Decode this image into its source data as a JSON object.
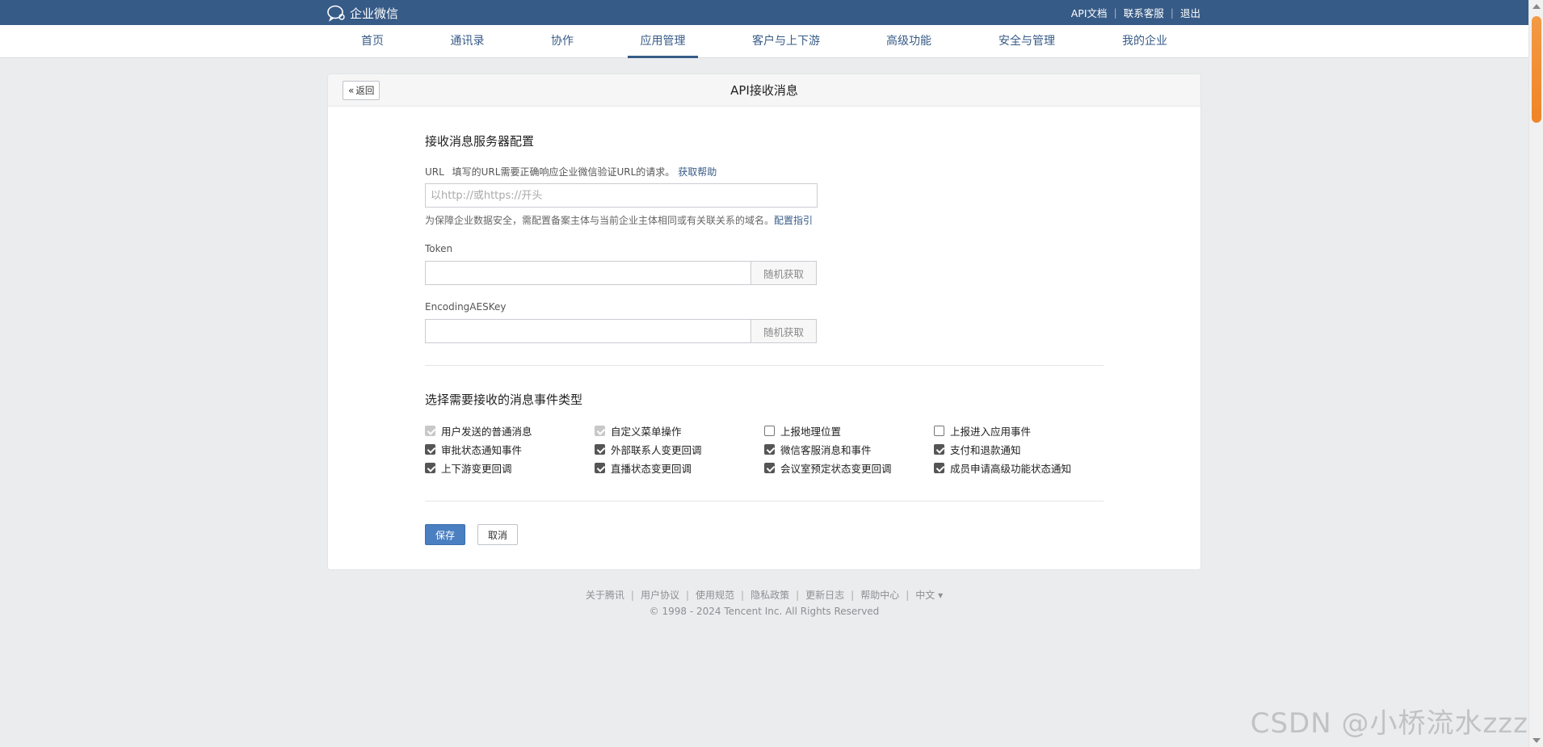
{
  "topbar": {
    "brand": "企业微信",
    "links": [
      "API文档",
      "联系客服",
      "退出"
    ],
    "separator": "|"
  },
  "nav": {
    "items": [
      "首页",
      "通讯录",
      "协作",
      "应用管理",
      "客户与上下游",
      "高级功能",
      "安全与管理",
      "我的企业"
    ],
    "active_index": 3
  },
  "card": {
    "back_label": "返回",
    "title": "API接收消息",
    "server_section_title": "接收消息服务器配置",
    "url": {
      "label": "URL",
      "desc": "填写的URL需要正确响应企业微信验证URL的请求。",
      "help": "获取帮助",
      "placeholder": "以http://或https://开头",
      "value": ""
    },
    "security_hint": "为保障企业数据安全，需配置备案主体与当前企业主体相同或有关联关系的域名。",
    "security_link": "配置指引",
    "token": {
      "label": "Token",
      "value": "",
      "button": "随机获取"
    },
    "aeskey": {
      "label": "EncodingAESKey",
      "value": "",
      "button": "随机获取"
    },
    "events_section_title": "选择需要接收的消息事件类型",
    "events": [
      {
        "label": "用户发送的普通消息",
        "state": "disabled"
      },
      {
        "label": "自定义菜单操作",
        "state": "disabled"
      },
      {
        "label": "上报地理位置",
        "state": "unchecked"
      },
      {
        "label": "上报进入应用事件",
        "state": "unchecked"
      },
      {
        "label": "审批状态通知事件",
        "state": "checked"
      },
      {
        "label": "外部联系人变更回调",
        "state": "checked"
      },
      {
        "label": "微信客服消息和事件",
        "state": "checked"
      },
      {
        "label": "支付和退款通知",
        "state": "checked"
      },
      {
        "label": "上下游变更回调",
        "state": "checked"
      },
      {
        "label": "直播状态变更回调",
        "state": "checked"
      },
      {
        "label": "会议室预定状态变更回调",
        "state": "checked"
      },
      {
        "label": "成员申请高级功能状态通知",
        "state": "checked"
      }
    ],
    "save_label": "保存",
    "cancel_label": "取消"
  },
  "footer": {
    "links": [
      "关于腾讯",
      "用户协议",
      "使用规范",
      "隐私政策",
      "更新日志",
      "帮助中心"
    ],
    "language": "中文 ▾",
    "copyright": "© 1998 - 2024 Tencent Inc. All Rights Reserved"
  },
  "watermark": "CSDN @小桥流水zzz",
  "colors": {
    "topbar": "#375b87",
    "primary_button": "#4a7fc1",
    "link": "#375b87",
    "background": "#ebecee",
    "scroll_thumb": "#f08427"
  }
}
